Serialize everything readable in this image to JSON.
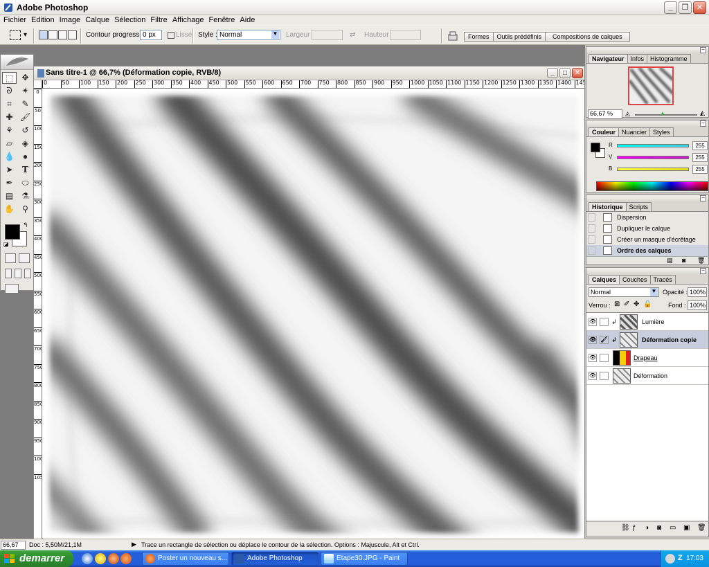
{
  "app": {
    "title": "Adobe Photoshop"
  },
  "menu": [
    "Fichier",
    "Edition",
    "Image",
    "Calque",
    "Sélection",
    "Filtre",
    "Affichage",
    "Fenêtre",
    "Aide"
  ],
  "options": {
    "contour_label": "Contour progressif :",
    "contour_value": "0 px",
    "lisse_label": "Lissé",
    "style_label": "Style :",
    "style_value": "Normal",
    "largeur_label": "Largeur :",
    "hauteur_label": "Hauteur :",
    "well_tabs": [
      "Formes",
      "Outils prédéfinis",
      "Compositions de calques"
    ]
  },
  "document": {
    "title": "Sans titre-1 @ 66,7% (Déformation copie, RVB/8)",
    "ruler_h": [
      "0",
      "50",
      "100",
      "150",
      "200",
      "250",
      "300",
      "350",
      "400",
      "450",
      "500",
      "550",
      "600",
      "650",
      "700",
      "750",
      "800",
      "850",
      "900",
      "950",
      "1000",
      "1050",
      "1100",
      "1150",
      "1200",
      "1250",
      "1300",
      "1350",
      "1400",
      "145"
    ],
    "ruler_v": [
      "0",
      "50",
      "100",
      "150",
      "200",
      "250",
      "300",
      "350",
      "400",
      "450",
      "500",
      "550",
      "600",
      "650",
      "700",
      "750",
      "800",
      "850",
      "900",
      "950",
      "1000",
      "1050"
    ]
  },
  "navigator": {
    "tabs": [
      "Navigateur",
      "Infos",
      "Histogramme"
    ],
    "zoom": "66,67 %"
  },
  "color": {
    "tabs": [
      "Couleur",
      "Nuancier",
      "Styles"
    ],
    "channels": [
      {
        "label": "R",
        "value": "255",
        "color": "#00c8d8"
      },
      {
        "label": "V",
        "value": "255",
        "color": "#d020d0"
      },
      {
        "label": "B",
        "value": "255",
        "color": "#e0e020"
      }
    ],
    "foreground": "#000000",
    "background": "#ffffff"
  },
  "history": {
    "tabs": [
      "Historique",
      "Scripts"
    ],
    "items": [
      "Dispersion",
      "Dupliquer le calque",
      "Créer un masque d'écrêtage",
      "Ordre des calques"
    ]
  },
  "layers": {
    "tabs": [
      "Calques",
      "Couches",
      "Tracés"
    ],
    "blend_mode": "Normal",
    "opacity_label": "Opacité :",
    "opacity_value": "100%",
    "lock_label": "Verrou :",
    "fill_label": "Fond :",
    "fill_value": "100%",
    "items": [
      {
        "name": "Lumière"
      },
      {
        "name": "Déformation copie"
      },
      {
        "name": "Drapeau"
      },
      {
        "name": "Déformation"
      }
    ]
  },
  "status": {
    "zoom": "66,67 %",
    "doc": "Doc : 5,50M/21,1M",
    "hint": "Trace un rectangle de sélection ou déplace le contour de la sélection. Options : Majuscule, Alt et Ctrl."
  },
  "taskbar": {
    "start": "demarrer",
    "tasks": [
      "Poster un nouveau s...",
      "Adobe Photoshop",
      "Etape30.JPG - Paint"
    ],
    "clock": "17:03",
    "tray_letter": "Z"
  }
}
